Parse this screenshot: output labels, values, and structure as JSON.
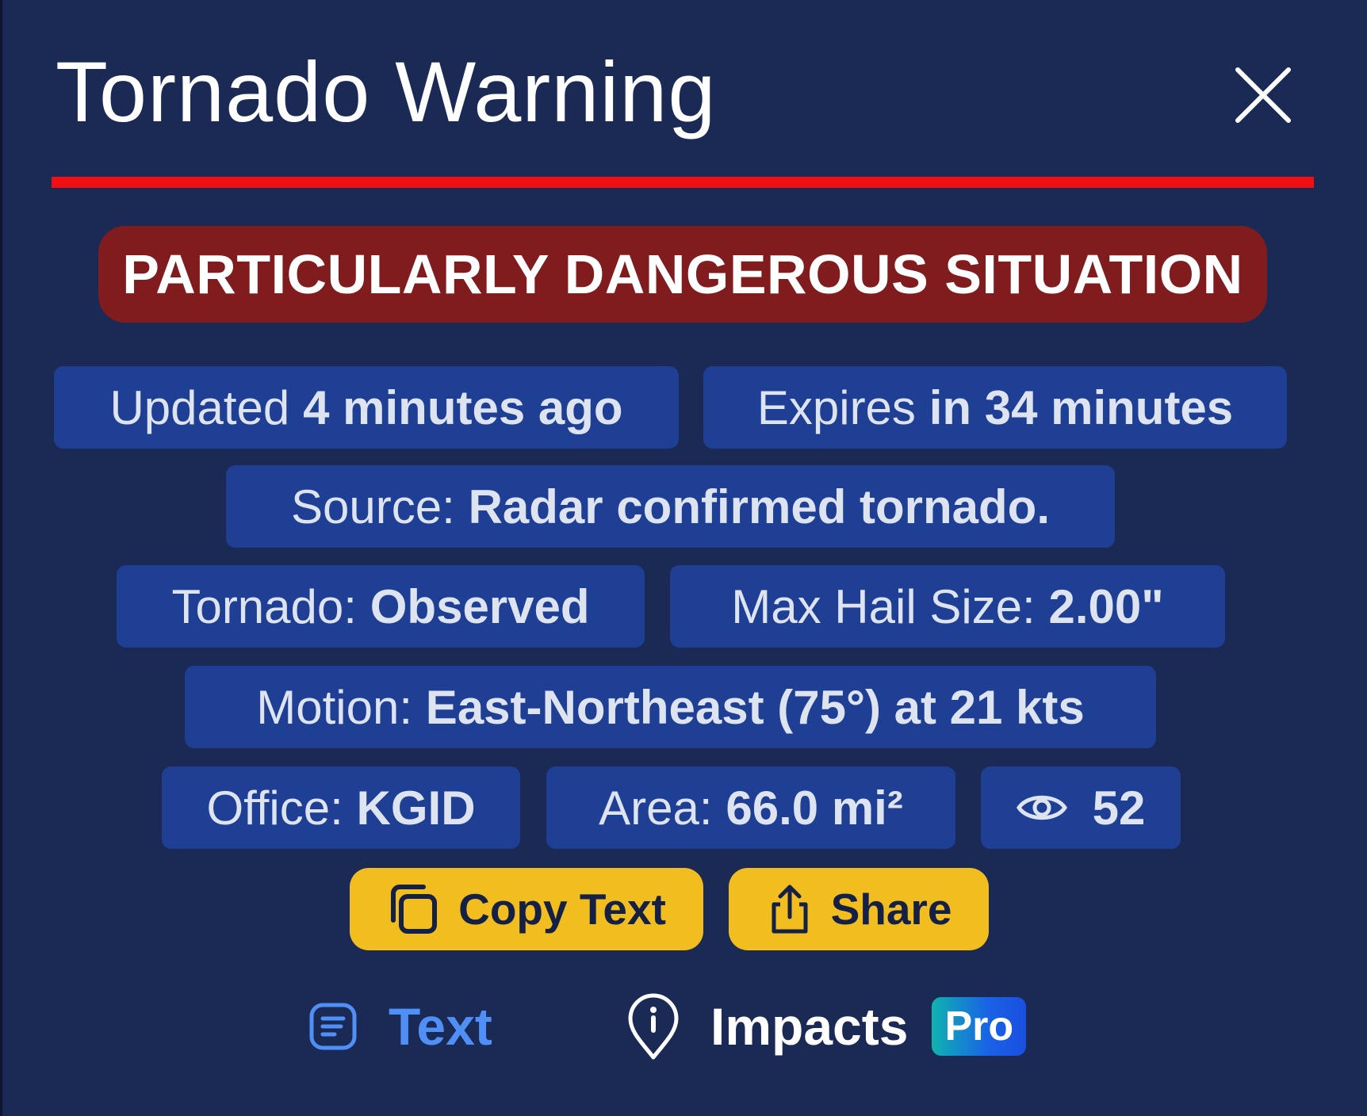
{
  "header": {
    "title": "Tornado Warning",
    "close_icon": "close-icon"
  },
  "colors": {
    "background": "#1b2a55",
    "divider": "#f20f14",
    "pds_banner": "#801b1e",
    "chip": "#1f3f95",
    "action_button": "#f2bd1f",
    "active_tab": "#4f8ff6"
  },
  "banner": {
    "text": "PARTICULARLY DANGEROUS SITUATION"
  },
  "details": {
    "updated": {
      "label": "Updated",
      "value": "4 minutes ago"
    },
    "expires": {
      "label": "Expires",
      "value": "in 34 minutes"
    },
    "source": {
      "label": "Source:",
      "value": "Radar confirmed tornado."
    },
    "tornado": {
      "label": "Tornado:",
      "value": "Observed"
    },
    "hail": {
      "label": "Max Hail Size:",
      "value": "2.00\""
    },
    "motion": {
      "label": "Motion:",
      "value": "East-Northeast (75°) at 21 kts"
    },
    "office": {
      "label": "Office:",
      "value": "KGID"
    },
    "area": {
      "label": "Area:",
      "value": "66.0 mi²"
    },
    "views": {
      "icon": "eye-icon",
      "value": "52"
    }
  },
  "actions": {
    "copy": {
      "label": "Copy Text",
      "icon": "copy-icon"
    },
    "share": {
      "label": "Share",
      "icon": "share-icon"
    }
  },
  "tabs": {
    "text": {
      "label": "Text",
      "icon": "document-icon"
    },
    "impacts": {
      "label": "Impacts",
      "icon": "info-pin-icon",
      "badge": "Pro"
    }
  }
}
